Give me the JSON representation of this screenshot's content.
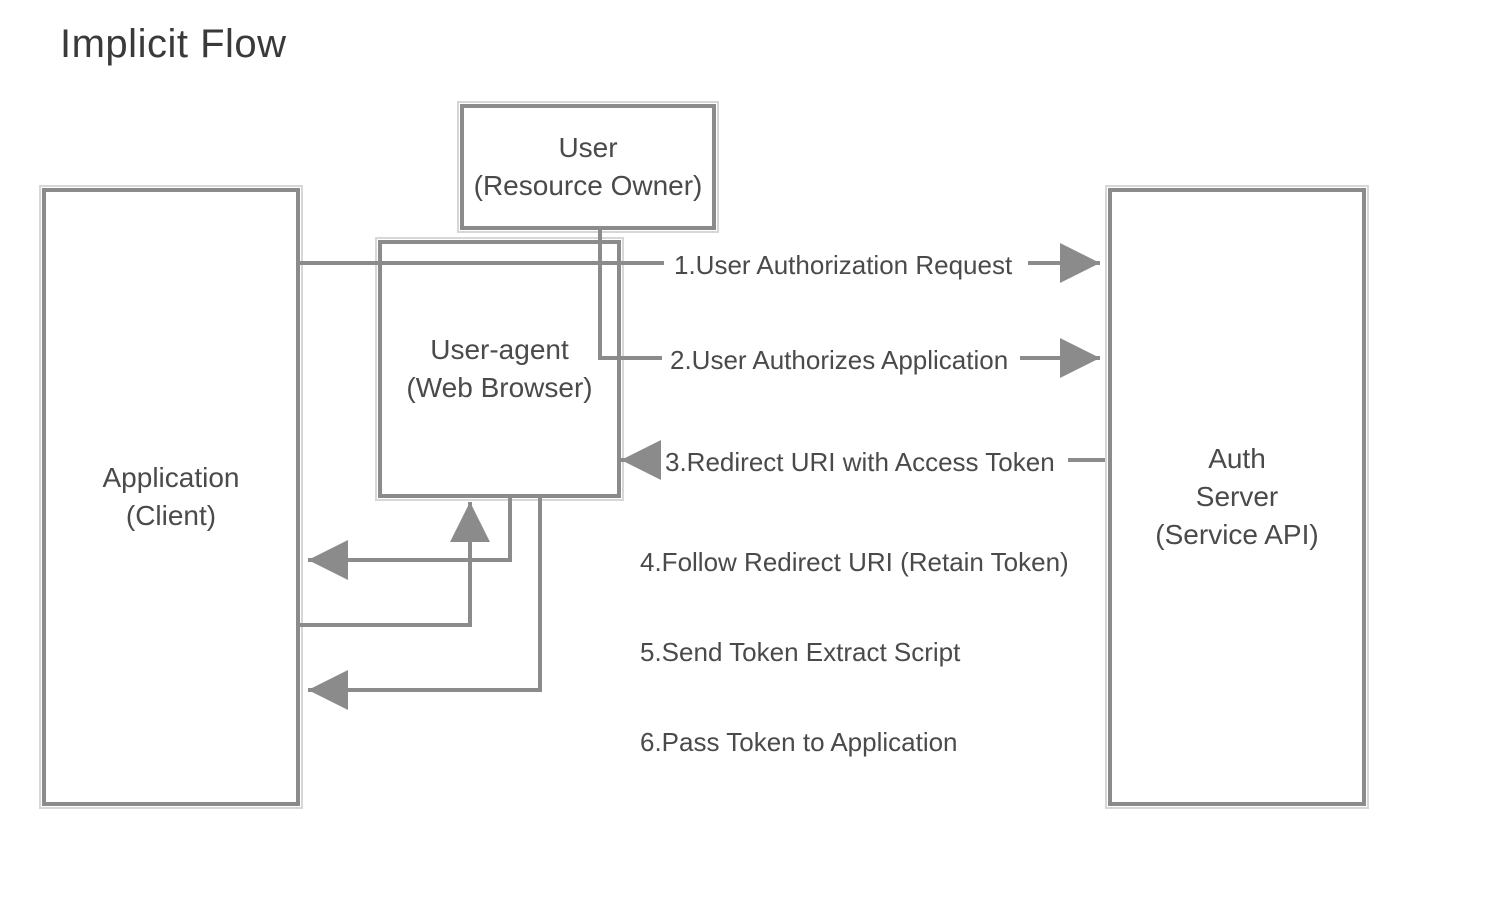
{
  "title": "Implicit Flow",
  "boxes": {
    "application": {
      "line1": "Application",
      "line2": "(Client)"
    },
    "user": {
      "line1": "User",
      "line2": "(Resource Owner)"
    },
    "user_agent": {
      "line1": "User-agent",
      "line2": "(Web Browser)"
    },
    "auth_server": {
      "line1": "Auth",
      "line2": "Server",
      "line3": "(Service API)"
    }
  },
  "steps": {
    "s1": "1.User Authorization Request",
    "s2": "2.User Authorizes Application",
    "s3": "3.Redirect URI with Access Token",
    "s4": "4.Follow Redirect URI (Retain Token)",
    "s5": "5.Send Token Extract Script",
    "s6": "6.Pass Token to Application"
  }
}
